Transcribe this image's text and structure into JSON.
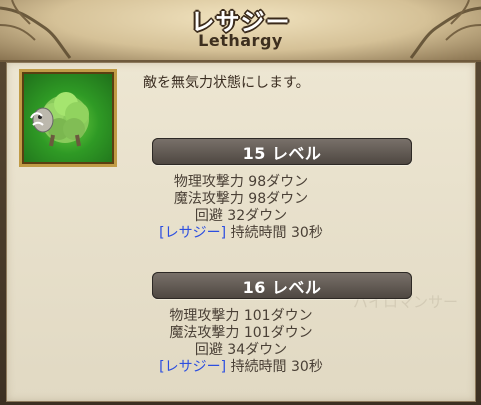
{
  "title": {
    "japanese": "レサジー",
    "english": "Lethargy"
  },
  "icon": {
    "name": "lethargy-icon"
  },
  "description": "敵を無気力状態にします。",
  "levels": [
    {
      "label": "15 レベル",
      "stats": [
        "物理攻撃力 98ダウン",
        "魔法攻撃力 98ダウン",
        "回避 32ダウン"
      ],
      "status_tag": "[レサジー]",
      "duration": "持続時間 30秒"
    },
    {
      "label": "16 レベル",
      "stats": [
        "物理攻撃力 101ダウン",
        "魔法攻撃力 101ダウン",
        "回避 34ダウン"
      ],
      "status_tag": "[レサジー]",
      "duration": "持続時間 30秒"
    }
  ],
  "background_watermark": "パイロマンサー",
  "colors": {
    "status_tag": "#2c4ee0",
    "stat_text": "#4a4036",
    "title_outline": "#3a2a1a",
    "icon_frame": "#c09b45"
  }
}
